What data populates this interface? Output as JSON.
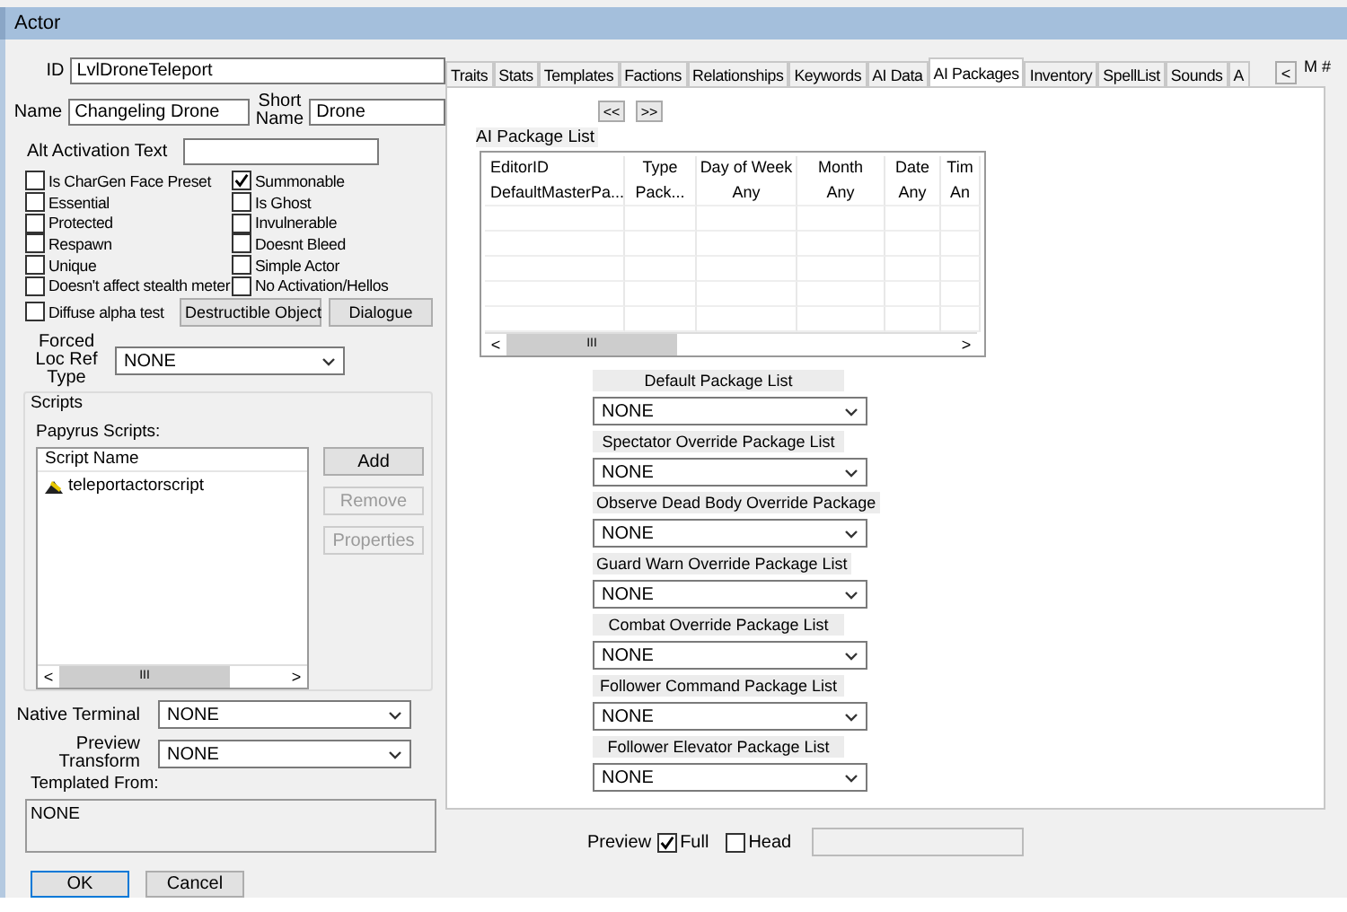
{
  "window": {
    "title": "Actor"
  },
  "id_field": {
    "label": "ID",
    "value": "LvlDroneTeleport"
  },
  "name_field": {
    "label": "Name",
    "value": "Changeling Drone"
  },
  "short_name_field": {
    "label": "Short Name",
    "value": "Drone"
  },
  "alt_activation_field": {
    "label": "Alt Activation Text"
  },
  "flags_left": [
    {
      "label": "Is CharGen Face Preset",
      "checked": false
    },
    {
      "label": "Essential",
      "checked": false
    },
    {
      "label": "Protected",
      "checked": false
    },
    {
      "label": "Respawn",
      "checked": false
    },
    {
      "label": "Unique",
      "checked": false
    },
    {
      "label": "Doesn't affect stealth meter",
      "checked": false
    },
    {
      "label": "Diffuse alpha test",
      "checked": false
    }
  ],
  "flags_right": [
    {
      "label": "Summonable",
      "checked": true
    },
    {
      "label": "Is Ghost",
      "checked": false
    },
    {
      "label": "Invulnerable",
      "checked": false
    },
    {
      "label": "Doesnt Bleed",
      "checked": false
    },
    {
      "label": "Simple Actor",
      "checked": false
    },
    {
      "label": "No Activation/Hellos",
      "checked": false
    }
  ],
  "object_buttons": [
    {
      "label": "Destructible Object"
    },
    {
      "label": "Dialogue"
    }
  ],
  "forced_loc": {
    "label": "Forced Loc Ref Type",
    "value": "NONE"
  },
  "scripts": {
    "group_label": "Scripts",
    "list_label": "Papyrus Scripts:",
    "column": "Script Name",
    "items": [
      {
        "name": "teleportactorscript"
      }
    ],
    "scroll_grip": "III",
    "scroll_arrows": [
      "<",
      ">"
    ],
    "buttons": [
      {
        "label": "Add",
        "disabled": false
      },
      {
        "label": "Remove",
        "disabled": true
      },
      {
        "label": "Properties",
        "disabled": true
      }
    ]
  },
  "native_terminal": {
    "label": "Native Terminal",
    "value": "NONE"
  },
  "preview_transform": {
    "label": "Preview Transform",
    "value": "NONE"
  },
  "templated_from": {
    "label": "Templated From:",
    "value": "NONE"
  },
  "dialog_buttons": [
    {
      "label": "OK"
    },
    {
      "label": "Cancel"
    }
  ],
  "tabs": [
    {
      "label": "Traits",
      "selected": false
    },
    {
      "label": "Stats",
      "selected": false
    },
    {
      "label": "Templates",
      "selected": false
    },
    {
      "label": "Factions",
      "selected": false
    },
    {
      "label": "Relationships",
      "selected": false
    },
    {
      "label": "Keywords",
      "selected": false
    },
    {
      "label": "AI Data",
      "selected": false
    },
    {
      "label": "AI Packages",
      "selected": true
    },
    {
      "label": "Inventory",
      "selected": false
    },
    {
      "label": "SpellList",
      "selected": false
    },
    {
      "label": "Sounds",
      "selected": false
    },
    {
      "label": "A",
      "selected": false
    }
  ],
  "tab_scroll": {
    "left": "<",
    "extra": "M #"
  },
  "ai_packages": {
    "nav_buttons": [
      "<<",
      ">>"
    ],
    "list_label": "AI Package List",
    "columns": [
      "EditorID",
      "Type",
      "Day of Week",
      "Month",
      "Date",
      "Tim"
    ],
    "rows": [
      [
        "DefaultMasterPa...",
        "Pack...",
        "Any",
        "Any",
        "Any",
        "An"
      ]
    ],
    "scroll_grip": "III",
    "scroll_arrows": [
      "<",
      ">"
    ],
    "package_lists": [
      {
        "label": "Default Package List",
        "value": "NONE"
      },
      {
        "label": "Spectator Override Package List",
        "value": "NONE"
      },
      {
        "label": "Observe Dead Body Override Package",
        "value": "NONE"
      },
      {
        "label": "Guard Warn Override Package List",
        "value": "NONE"
      },
      {
        "label": "Combat Override Package List",
        "value": "NONE"
      },
      {
        "label": "Follower Command Package List",
        "value": "NONE"
      },
      {
        "label": "Follower Elevator Package List",
        "value": "NONE"
      }
    ]
  },
  "preview": {
    "label": "Preview",
    "options": [
      {
        "label": "Full",
        "checked": true
      },
      {
        "label": "Head",
        "checked": false
      }
    ]
  }
}
